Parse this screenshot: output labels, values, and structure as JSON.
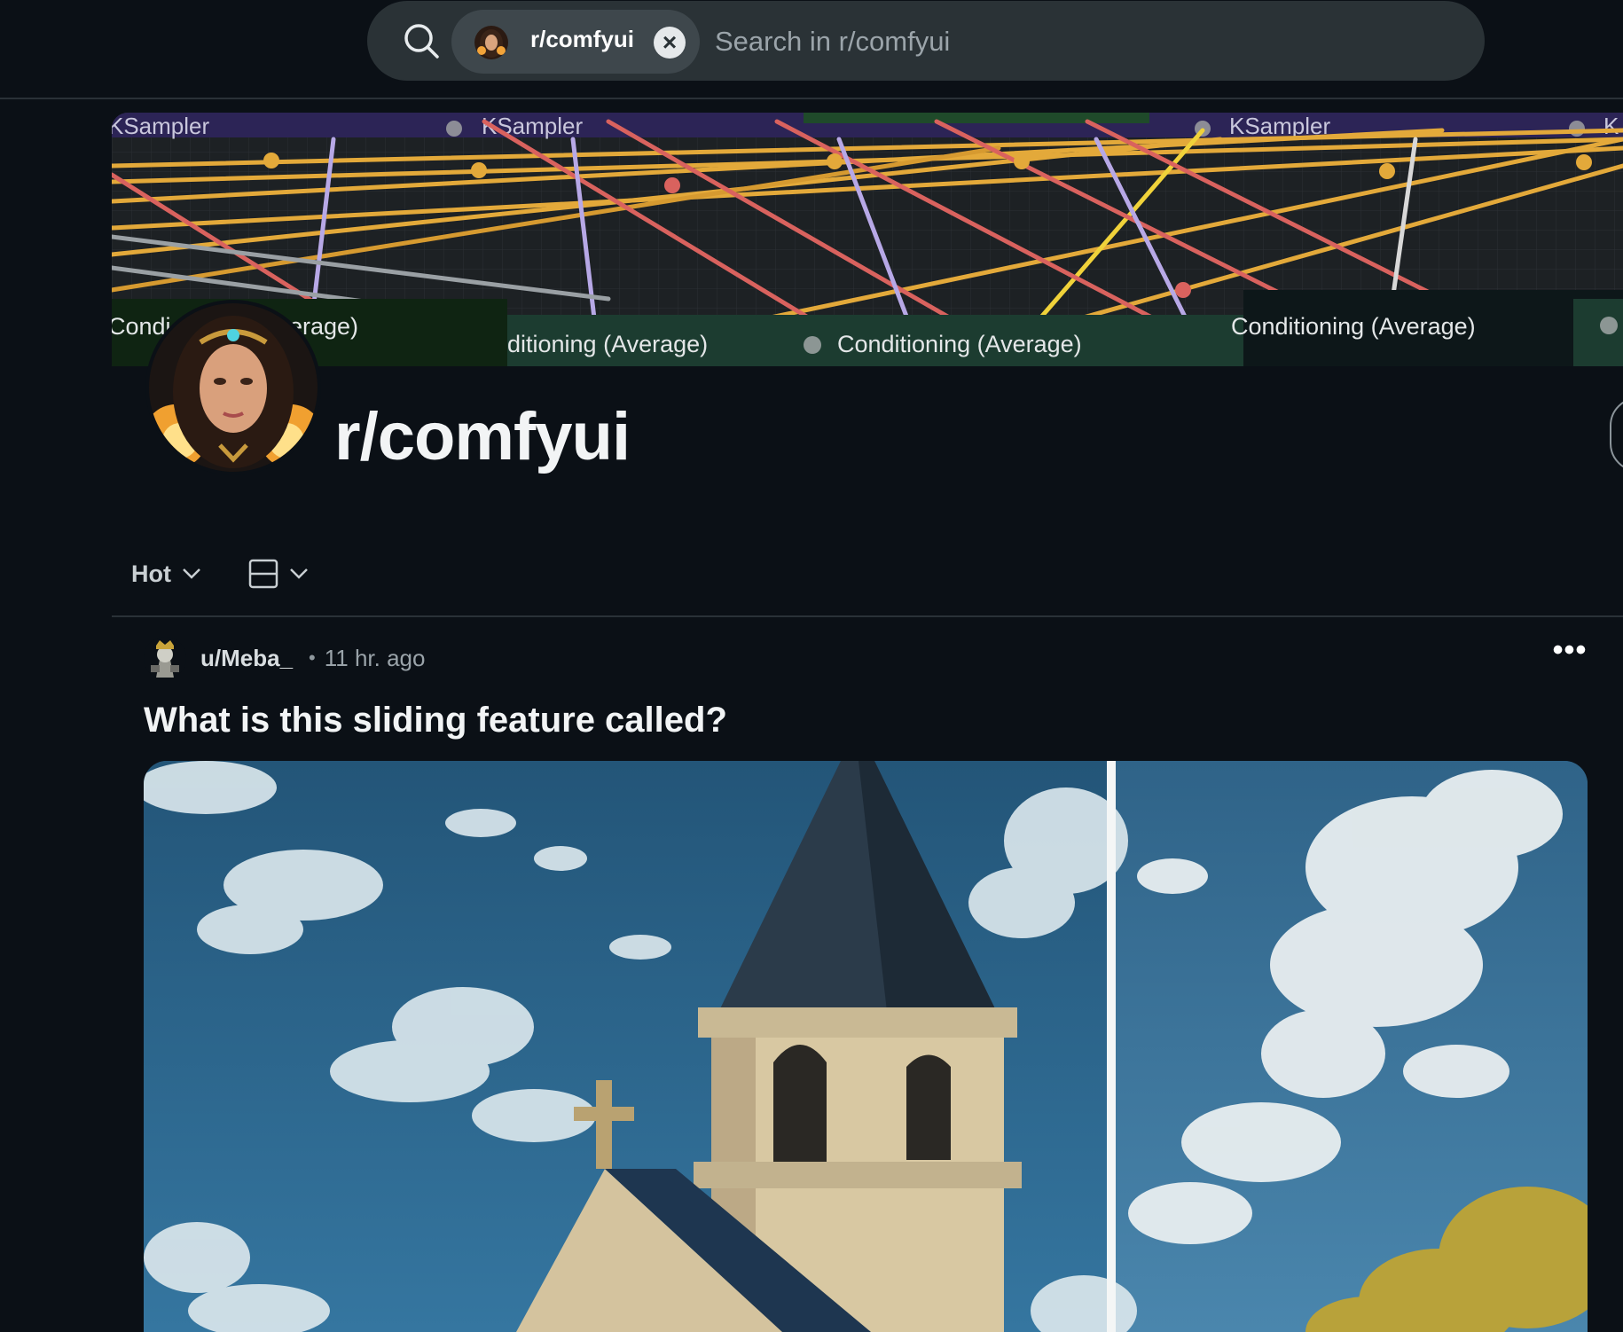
{
  "search": {
    "community_chip": "r/comfyui",
    "placeholder": "Search in r/comfyui",
    "close_symbol": "×"
  },
  "banner": {
    "node_labels_top": [
      "KSampler",
      "KSampler",
      "KSampler",
      "K"
    ],
    "node_labels_bottom": [
      "Condi",
      "erage)",
      "ditioning (Average)",
      "Conditioning (Average)",
      "Conditioning (Average)"
    ]
  },
  "community": {
    "name": "r/comfyui"
  },
  "sort": {
    "label": "Hot"
  },
  "post": {
    "username": "u/Meba_",
    "separator": "•",
    "time": "11 hr. ago",
    "title": "What is this sliding feature called?",
    "more_symbol": "•••"
  },
  "colors": {
    "background": "#0b1016",
    "search_bar": "#2a3236",
    "chip": "#3e474c",
    "wire_orange": "#e3a93a",
    "wire_red": "#d9625e",
    "wire_purple": "#b7a8e6"
  },
  "icons": [
    "search-icon",
    "close-icon",
    "chevron-down-icon",
    "card-view-icon",
    "more-options-icon"
  ]
}
